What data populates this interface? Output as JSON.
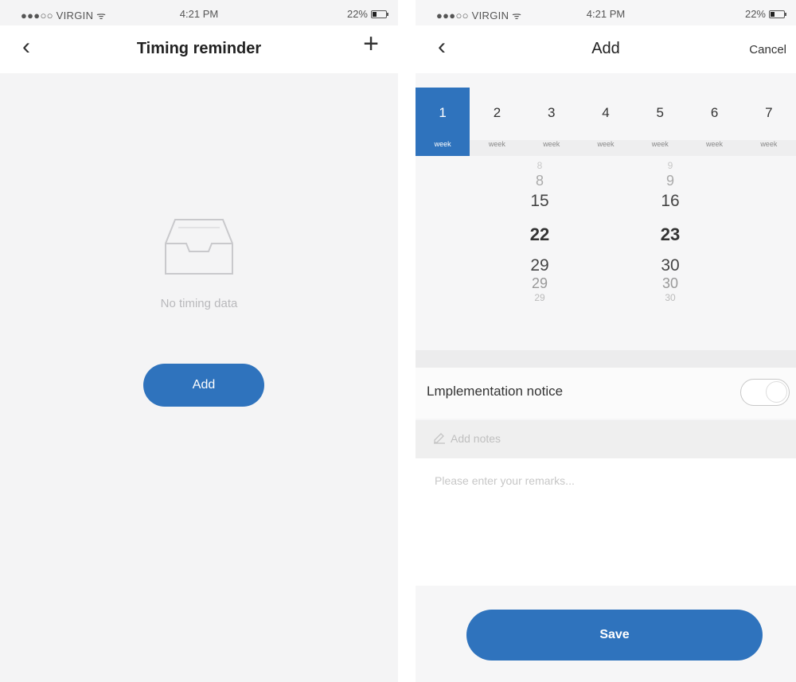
{
  "left_screen": {
    "status": {
      "carrier": "●●●○○ VIRGIN ᯤ",
      "time": "4:21 PM",
      "battery": "22%"
    },
    "nav": {
      "back_icon": "‹",
      "title": "Timing reminder",
      "add_icon": "+"
    },
    "empty_state": {
      "icon": "inbox-tray-icon",
      "message": "No timing data"
    },
    "add_button": "Add"
  },
  "right_screen": {
    "status": {
      "carrier": "●●●○○ VIRGIN ᯤ",
      "time": "4:21 PM",
      "battery": "22%"
    },
    "nav": {
      "back_icon": "‹",
      "title": "Add",
      "cancel": "Cancel"
    },
    "week_days": [
      {
        "num": "1",
        "label": "week",
        "selected": true
      },
      {
        "num": "2",
        "label": "week",
        "selected": false
      },
      {
        "num": "3",
        "label": "week",
        "selected": false
      },
      {
        "num": "4",
        "label": "week",
        "selected": false
      },
      {
        "num": "5",
        "label": "week",
        "selected": false
      },
      {
        "num": "6",
        "label": "week",
        "selected": false
      },
      {
        "num": "7",
        "label": "week",
        "selected": false
      }
    ],
    "picker": {
      "col1": [
        "8",
        "8",
        "15",
        "22",
        "29",
        "29",
        "29"
      ],
      "col2": [
        "9",
        "9",
        "16",
        "23",
        "30",
        "30",
        "30"
      ]
    },
    "notice": {
      "label": "Lmplementation notice",
      "enabled": false
    },
    "notes": {
      "icon": "edit-icon",
      "header": "Add notes",
      "placeholder": "Please enter your remarks..."
    },
    "save_button": "Save"
  },
  "colors": {
    "accent": "#2f73bd",
    "background": "#f4f4f5"
  }
}
